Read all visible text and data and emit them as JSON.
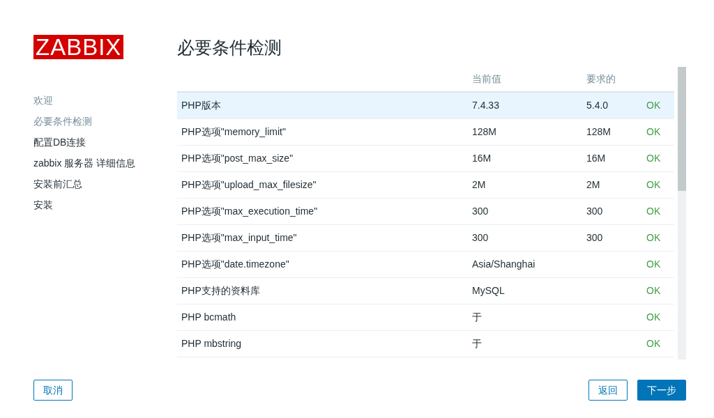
{
  "logo": "ZABBIX",
  "steps": [
    {
      "label": "欢迎",
      "completed": true
    },
    {
      "label": "必要条件检测",
      "completed": true
    },
    {
      "label": "配置DB连接",
      "completed": false
    },
    {
      "label": "zabbix 服务器 详细信息",
      "completed": false
    },
    {
      "label": "安装前汇总",
      "completed": false
    },
    {
      "label": "安装",
      "completed": false
    }
  ],
  "title": "必要条件检测",
  "table": {
    "columns": [
      "当前值",
      "要求的"
    ],
    "rows": [
      {
        "name": "PHP版本",
        "current": "7.4.33",
        "required": "5.4.0",
        "status": "OK",
        "highlighted": true
      },
      {
        "name": "PHP选项\"memory_limit\"",
        "current": "128M",
        "required": "128M",
        "status": "OK",
        "highlighted": false
      },
      {
        "name": "PHP选项\"post_max_size\"",
        "current": "16M",
        "required": "16M",
        "status": "OK",
        "highlighted": false
      },
      {
        "name": "PHP选项\"upload_max_filesize\"",
        "current": "2M",
        "required": "2M",
        "status": "OK",
        "highlighted": false
      },
      {
        "name": "PHP选项\"max_execution_time\"",
        "current": "300",
        "required": "300",
        "status": "OK",
        "highlighted": false
      },
      {
        "name": "PHP选项\"max_input_time\"",
        "current": "300",
        "required": "300",
        "status": "OK",
        "highlighted": false
      },
      {
        "name": "PHP选项\"date.timezone\"",
        "current": "Asia/Shanghai",
        "required": "",
        "status": "OK",
        "highlighted": false
      },
      {
        "name": "PHP支持的资料库",
        "current": "MySQL",
        "required": "",
        "status": "OK",
        "highlighted": false
      },
      {
        "name": "PHP bcmath",
        "current": "于",
        "required": "",
        "status": "OK",
        "highlighted": false
      },
      {
        "name": "PHP mbstring",
        "current": "于",
        "required": "",
        "status": "OK",
        "highlighted": false
      }
    ]
  },
  "buttons": {
    "cancel": "取消",
    "back": "返回",
    "next": "下一步"
  }
}
